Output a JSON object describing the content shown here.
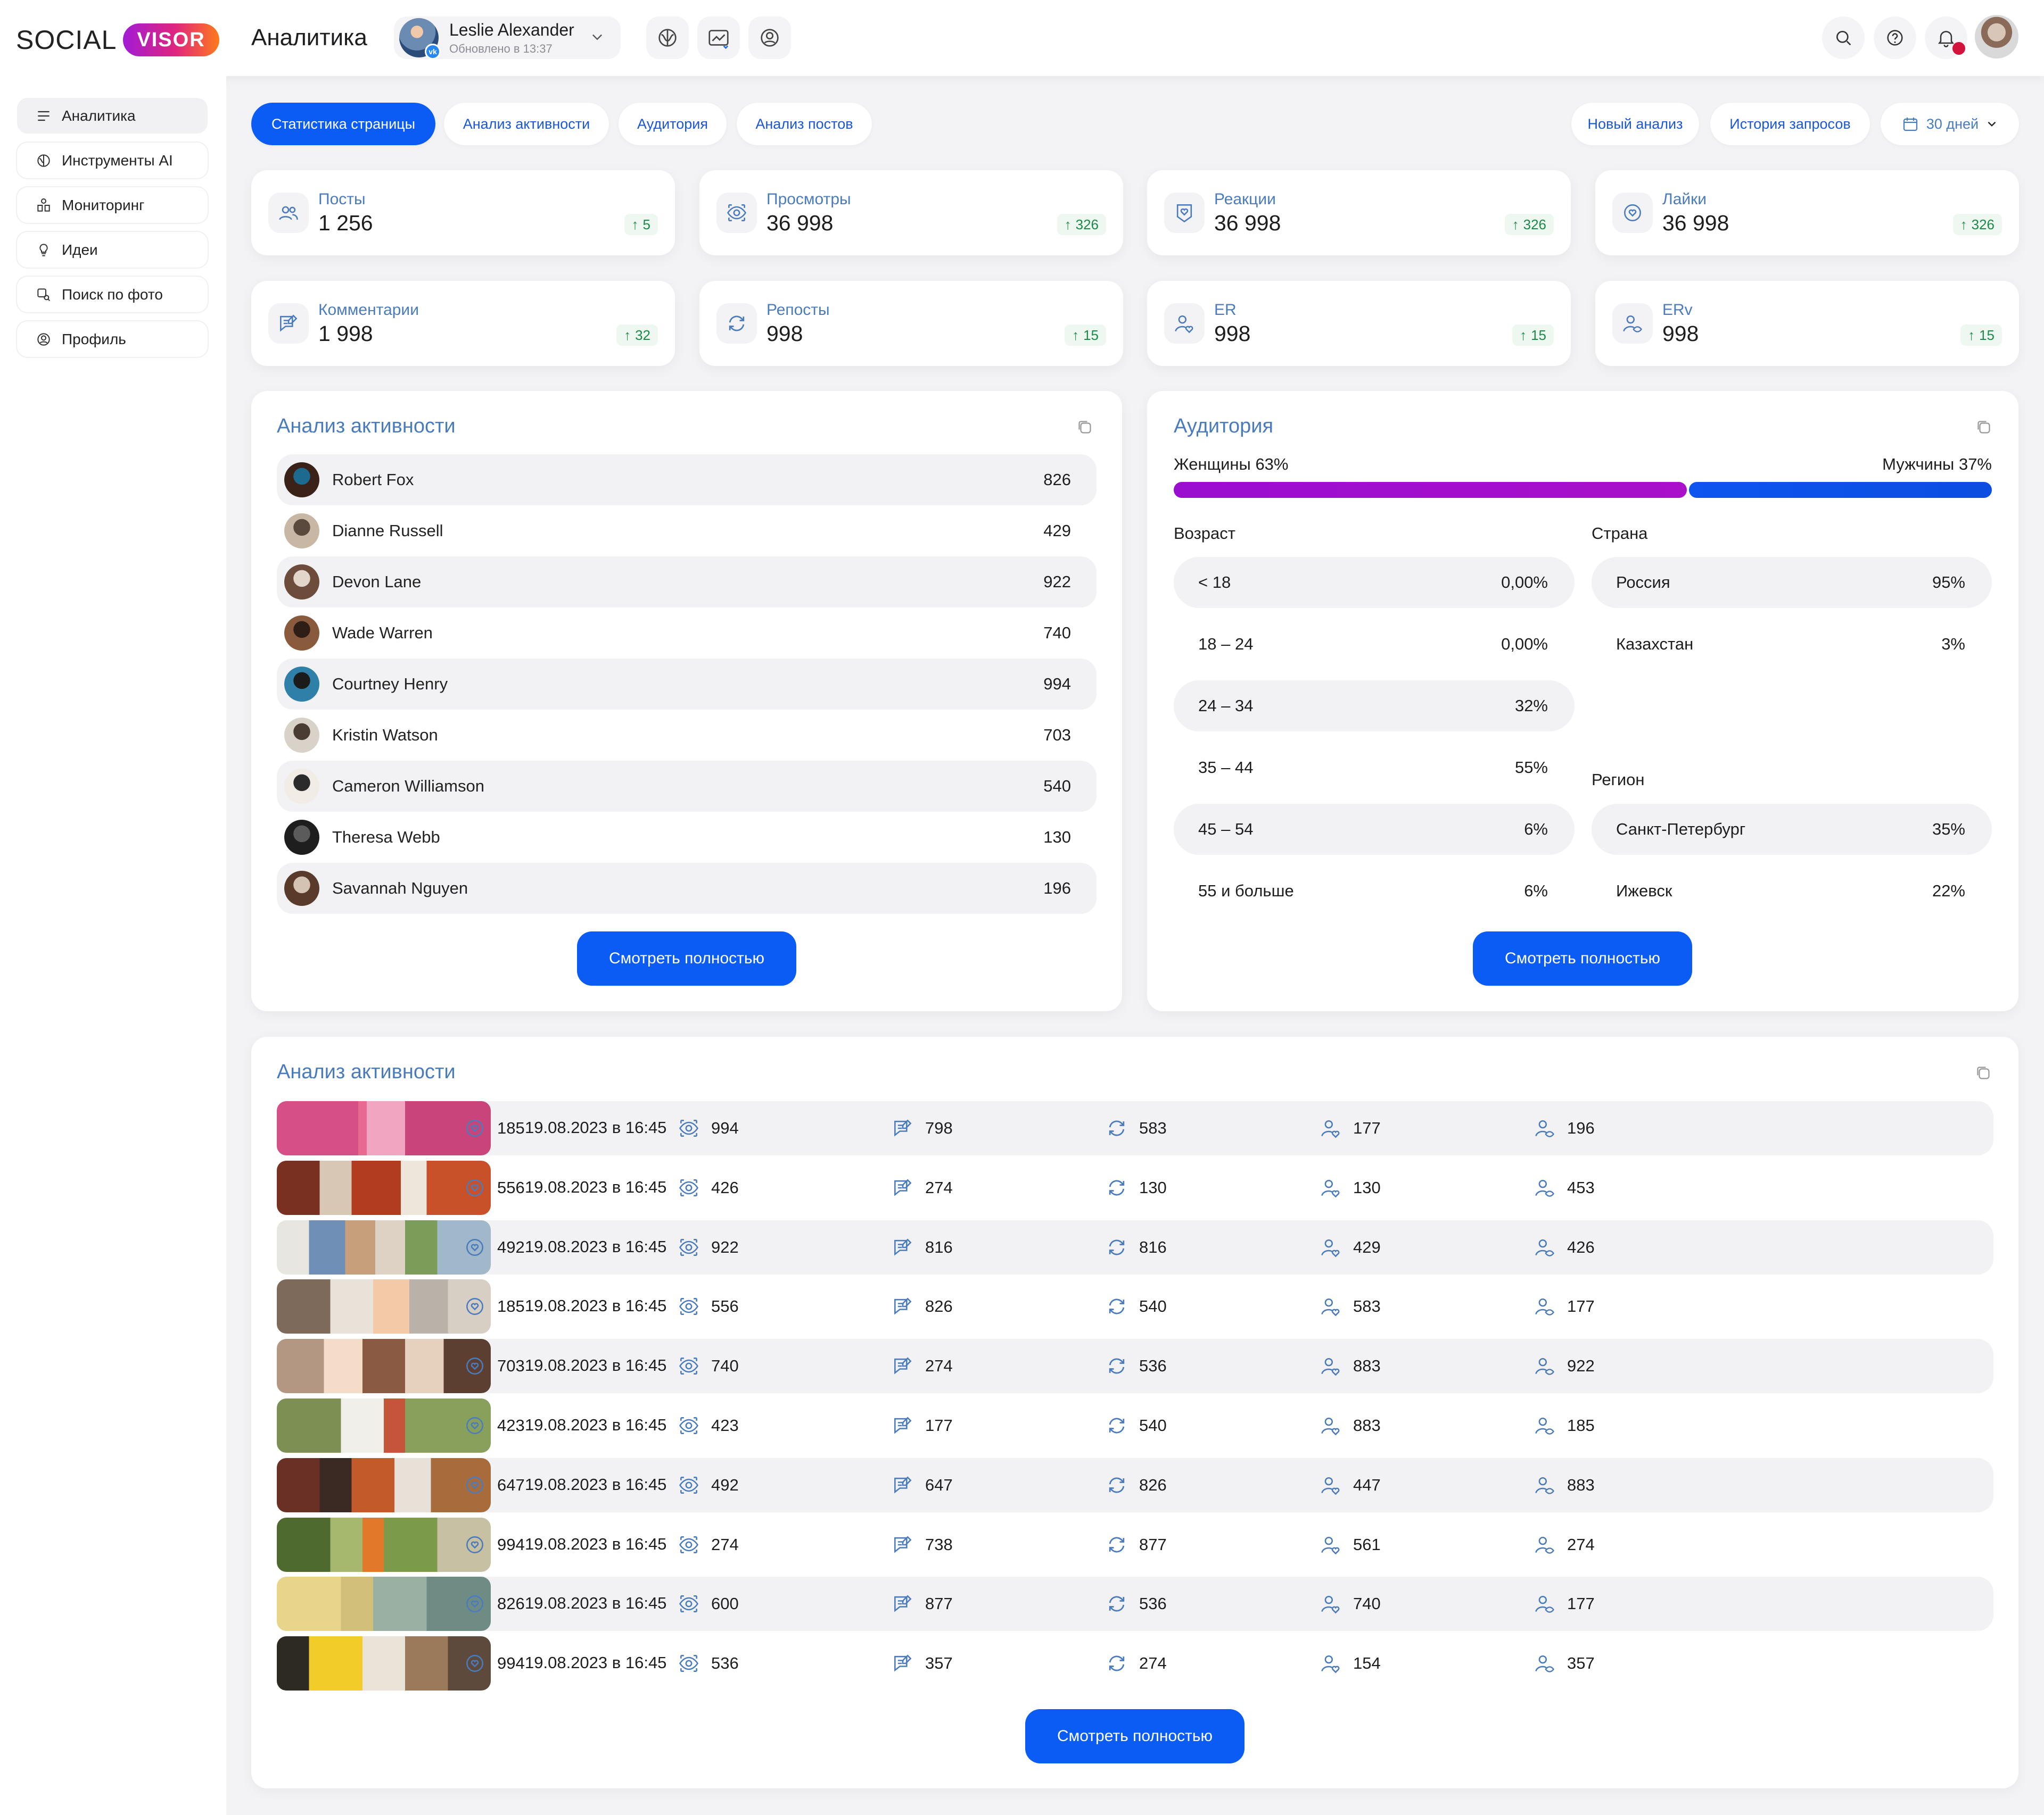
{
  "brand": {
    "part1": "SOCIAL",
    "part2": "VISOR"
  },
  "header": {
    "title": "Аналитика",
    "account": {
      "name": "Leslie Alexander",
      "updated": "Обновлено в 13:37",
      "network_badge": "vk"
    }
  },
  "sidebar": {
    "items": [
      {
        "label": "Аналитика",
        "icon": "analytics-icon",
        "active": true
      },
      {
        "label": "Инструменты AI",
        "icon": "ai-brain-icon",
        "active": false
      },
      {
        "label": "Мониторинг",
        "icon": "monitoring-icon",
        "active": false
      },
      {
        "label": "Идеи",
        "icon": "lightbulb-icon",
        "active": false
      },
      {
        "label": "Поиск по фото",
        "icon": "photo-search-icon",
        "active": false
      },
      {
        "label": "Профиль",
        "icon": "profile-icon",
        "active": false
      }
    ]
  },
  "tabs": [
    {
      "label": "Статистика страницы",
      "active": true
    },
    {
      "label": "Анализ активности",
      "active": false
    },
    {
      "label": "Аудитория",
      "active": false
    },
    {
      "label": "Анализ постов",
      "active": false
    }
  ],
  "actions": {
    "new_analysis": "Новый анализ",
    "history": "История запросов",
    "period": "30 дней"
  },
  "stats": [
    {
      "label": "Посты",
      "value": "1 256",
      "delta": "5",
      "icon": "users-icon"
    },
    {
      "label": "Просмотры",
      "value": "36 998",
      "delta": "326",
      "icon": "eye-icon"
    },
    {
      "label": "Реакции",
      "value": "36 998",
      "delta": "326",
      "icon": "reaction-heart-icon"
    },
    {
      "label": "Лайки",
      "value": "36 998",
      "delta": "326",
      "icon": "like-icon"
    },
    {
      "label": "Комментарии",
      "value": "1 998",
      "delta": "32",
      "icon": "comment-icon"
    },
    {
      "label": "Репосты",
      "value": "998",
      "delta": "15",
      "icon": "repost-icon"
    },
    {
      "label": "ER",
      "value": "998",
      "delta": "15",
      "icon": "user-heart-icon"
    },
    {
      "label": "ERv",
      "value": "998",
      "delta": "15",
      "icon": "user-eye-icon"
    }
  ],
  "activity": {
    "title": "Анализ активности",
    "people": [
      {
        "name": "Robert Fox",
        "value": "826"
      },
      {
        "name": "Dianne Russell",
        "value": "429"
      },
      {
        "name": "Devon Lane",
        "value": "922"
      },
      {
        "name": "Wade Warren",
        "value": "740"
      },
      {
        "name": "Courtney Henry",
        "value": "994"
      },
      {
        "name": "Kristin Watson",
        "value": "703"
      },
      {
        "name": "Cameron Williamson",
        "value": "540"
      },
      {
        "name": "Theresa Webb",
        "value": "130"
      },
      {
        "name": "Savannah Nguyen",
        "value": "196"
      }
    ],
    "button": "Смотреть полностью"
  },
  "audience": {
    "title": "Аудитория",
    "women_label": "Женщины 63%",
    "men_label": "Мужчины 37%",
    "women_share": 0.63,
    "men_share": 0.37,
    "colors": {
      "women": "#a810c9",
      "men": "#0b4ee0"
    },
    "age_title": "Возраст",
    "ages": [
      {
        "k": "< 18",
        "v": "0,00%"
      },
      {
        "k": "18 – 24",
        "v": "0,00%"
      },
      {
        "k": "24 – 34",
        "v": "32%"
      },
      {
        "k": "35 – 44",
        "v": "55%"
      },
      {
        "k": "45 – 54",
        "v": "6%"
      },
      {
        "k": "55 и больше",
        "v": "6%"
      }
    ],
    "country_title": "Страна",
    "countries": [
      {
        "k": "Россия",
        "v": "95%"
      },
      {
        "k": "Казахстан",
        "v": "3%"
      }
    ],
    "region_title": "Регион",
    "regions": [
      {
        "k": "Санкт-Петербург",
        "v": "35%"
      },
      {
        "k": "Ижевск",
        "v": "22%"
      }
    ],
    "button": "Смотреть полностью"
  },
  "posts": {
    "title": "Анализ активности",
    "button": "Смотреть полностью",
    "rows": [
      {
        "date": "19.08.2023 в 16:45",
        "v": [
          "185",
          "994",
          "798",
          "583",
          "177",
          "196"
        ]
      },
      {
        "date": "19.08.2023 в 16:45",
        "v": [
          "556",
          "426",
          "274",
          "130",
          "130",
          "453"
        ]
      },
      {
        "date": "19.08.2023 в 16:45",
        "v": [
          "492",
          "922",
          "816",
          "816",
          "429",
          "426"
        ]
      },
      {
        "date": "19.08.2023 в 16:45",
        "v": [
          "185",
          "556",
          "826",
          "540",
          "583",
          "177"
        ]
      },
      {
        "date": "19.08.2023 в 16:45",
        "v": [
          "703",
          "740",
          "274",
          "536",
          "883",
          "922"
        ]
      },
      {
        "date": "19.08.2023 в 16:45",
        "v": [
          "423",
          "423",
          "177",
          "540",
          "883",
          "185"
        ]
      },
      {
        "date": "19.08.2023 в 16:45",
        "v": [
          "647",
          "492",
          "647",
          "826",
          "447",
          "883"
        ]
      },
      {
        "date": "19.08.2023 в 16:45",
        "v": [
          "994",
          "274",
          "738",
          "877",
          "561",
          "274"
        ]
      },
      {
        "date": "19.08.2023 в 16:45",
        "v": [
          "826",
          "600",
          "877",
          "536",
          "740",
          "177"
        ]
      },
      {
        "date": "19.08.2023 в 16:45",
        "v": [
          "994",
          "536",
          "357",
          "274",
          "154",
          "357"
        ]
      }
    ]
  },
  "colors": {
    "accent": "#0a5cf5",
    "label_blue": "#4a7cbd",
    "positive": "#1e8a4a",
    "notification": "#d2143a"
  }
}
